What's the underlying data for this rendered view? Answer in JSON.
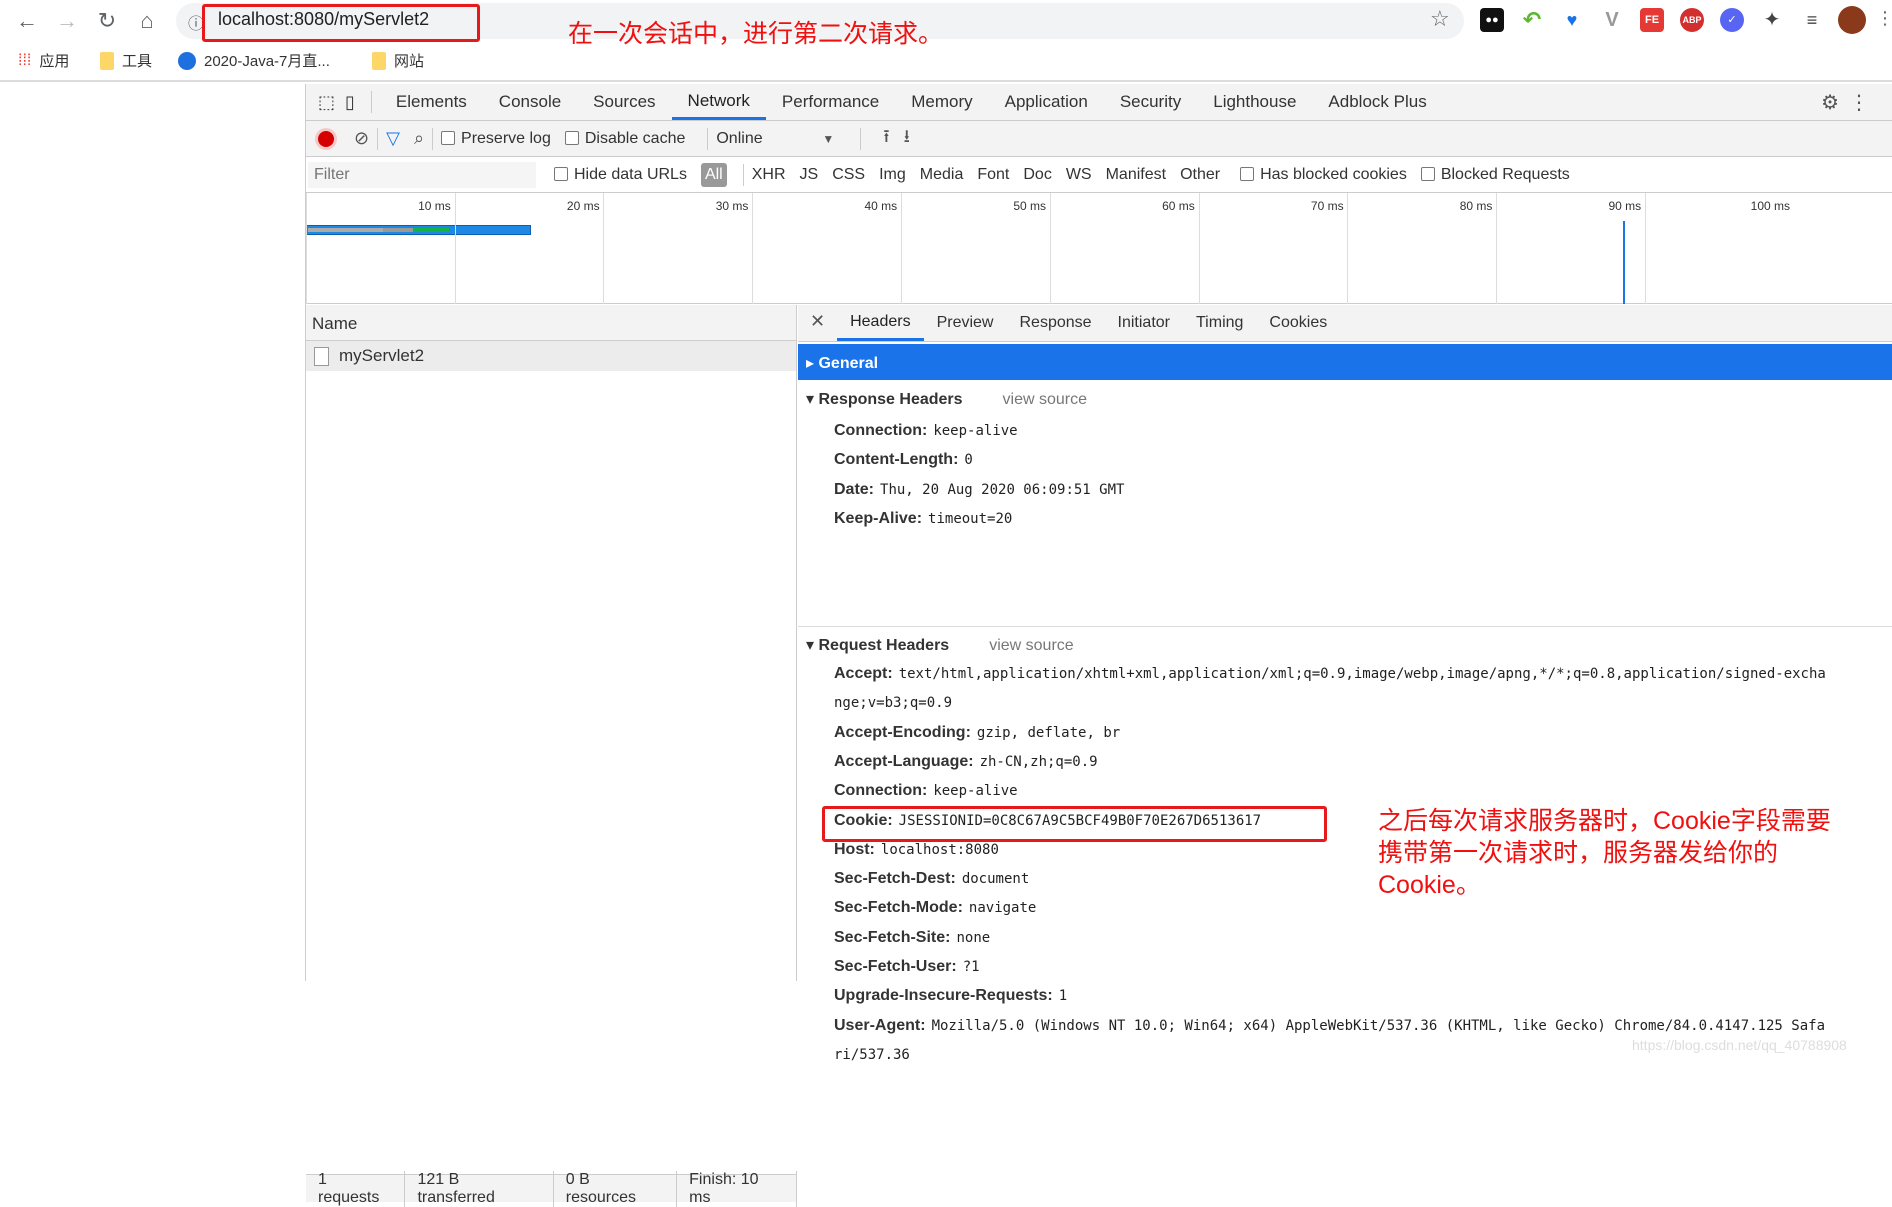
{
  "browser": {
    "url": "localhost:8080/myServlet2",
    "bookmarks": [
      {
        "label": "应用"
      },
      {
        "label": "工具"
      },
      {
        "label": "2020-Java-7月直..."
      },
      {
        "label": "网站"
      }
    ]
  },
  "annotations": {
    "top": "在一次会话中，进行第二次请求。",
    "cookie": [
      "之后每次请求服务器时，Cookie字段需要",
      "携带第一次请求时，服务器发给你的",
      "Cookie。"
    ]
  },
  "devtools": {
    "tabs": [
      "Elements",
      "Console",
      "Sources",
      "Network",
      "Performance",
      "Memory",
      "Application",
      "Security",
      "Lighthouse",
      "Adblock Plus"
    ],
    "active_tab": "Network",
    "toolbar": {
      "preserve_log": "Preserve log",
      "disable_cache": "Disable cache",
      "throttle": "Online"
    },
    "filter": {
      "placeholder": "Filter",
      "hide_data_urls": "Hide data URLs",
      "types": [
        "All",
        "XHR",
        "JS",
        "CSS",
        "Img",
        "Media",
        "Font",
        "Doc",
        "WS",
        "Manifest",
        "Other"
      ],
      "has_blocked_cookies": "Has blocked cookies",
      "blocked_requests": "Blocked Requests"
    },
    "timeline_ticks": [
      "10 ms",
      "20 ms",
      "30 ms",
      "40 ms",
      "50 ms",
      "60 ms",
      "70 ms",
      "80 ms",
      "90 ms",
      "100 ms"
    ],
    "name_header": "Name",
    "requests": [
      {
        "name": "myServlet2"
      }
    ],
    "detail_tabs": [
      "Headers",
      "Preview",
      "Response",
      "Initiator",
      "Timing",
      "Cookies"
    ],
    "general": "General",
    "response_headers": {
      "title": "Response Headers",
      "view_source": "view source",
      "items": [
        {
          "k": "Connection:",
          "v": "keep-alive"
        },
        {
          "k": "Content-Length:",
          "v": "0"
        },
        {
          "k": "Date:",
          "v": "Thu, 20 Aug 2020 06:09:51 GMT"
        },
        {
          "k": "Keep-Alive:",
          "v": "timeout=20"
        }
      ]
    },
    "request_headers": {
      "title": "Request Headers",
      "view_source": "view source",
      "items": [
        {
          "k": "Accept:",
          "v": "text/html,application/xhtml+xml,application/xml;q=0.9,image/webp,image/apng,*/*;q=0.8,application/signed-excha",
          "cont": "nge;v=b3;q=0.9"
        },
        {
          "k": "Accept-Encoding:",
          "v": "gzip, deflate, br"
        },
        {
          "k": "Accept-Language:",
          "v": "zh-CN,zh;q=0.9"
        },
        {
          "k": "Connection:",
          "v": "keep-alive"
        },
        {
          "k": "Cookie:",
          "v": "JSESSIONID=0C8C67A9C5BCF49B0F70E267D6513617"
        },
        {
          "k": "Host:",
          "v": "localhost:8080"
        },
        {
          "k": "Sec-Fetch-Dest:",
          "v": "document"
        },
        {
          "k": "Sec-Fetch-Mode:",
          "v": "navigate"
        },
        {
          "k": "Sec-Fetch-Site:",
          "v": "none"
        },
        {
          "k": "Sec-Fetch-User:",
          "v": "?1"
        },
        {
          "k": "Upgrade-Insecure-Requests:",
          "v": "1"
        },
        {
          "k": "User-Agent:",
          "v": "Mozilla/5.0 (Windows NT 10.0; Win64; x64) AppleWebKit/537.36 (KHTML, like Gecko) Chrome/84.0.4147.125 Safa",
          "cont": "ri/537.36"
        }
      ]
    },
    "status": [
      "1 requests",
      "121 B transferred",
      "0 B resources",
      "Finish: 10 ms"
    ]
  },
  "watermark": "https://blog.csdn.net/qq_40788908",
  "colors": {
    "accent": "#1a73e8",
    "annotation": "#e8191a"
  }
}
